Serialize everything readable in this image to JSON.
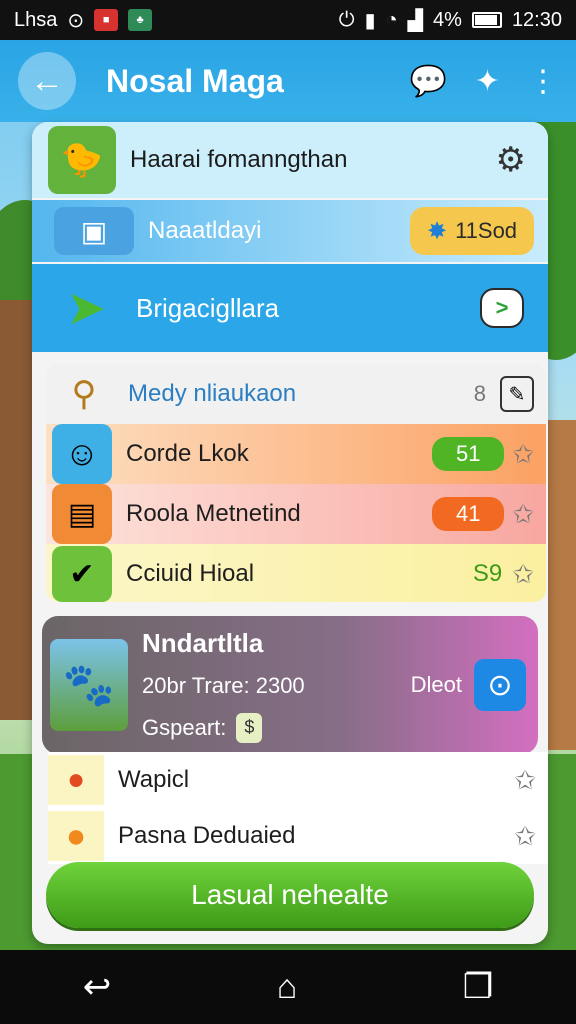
{
  "status_bar": {
    "carrier": "Lhsa",
    "battery": "4%",
    "time": "12:30"
  },
  "appbar": {
    "title": "Nosal Maga"
  },
  "menu": {
    "row1": {
      "label": "Haarai fomanngthan"
    },
    "row2": {
      "label": "Naaatldayi",
      "chip": "11Sod"
    },
    "row3": {
      "label": "Brigacigllara"
    }
  },
  "list": [
    {
      "label": "Medy nliaukaon",
      "value": "8"
    },
    {
      "label": "Corde Lkok",
      "value": "51"
    },
    {
      "label": "Roola Metnetind",
      "value": "41"
    },
    {
      "label": "Cciuid Hioal",
      "value": "S9"
    }
  ],
  "feature": {
    "title": "Nndartltla",
    "subtitle": "20br Trare: 2300",
    "price_label": "Gspeart:",
    "badge": "Dleot"
  },
  "bottom_items": [
    {
      "label": "Wapicl"
    },
    {
      "label": "Pasna Deduaied"
    }
  ],
  "cta": {
    "label": "Lasual nehealte"
  },
  "colors": {
    "appbar": "#2aa4e4",
    "cta": "#4fb525",
    "orange_row": "#fbbd84",
    "red_row": "#f7b0a4",
    "yellow_row": "#fbf1a6"
  }
}
